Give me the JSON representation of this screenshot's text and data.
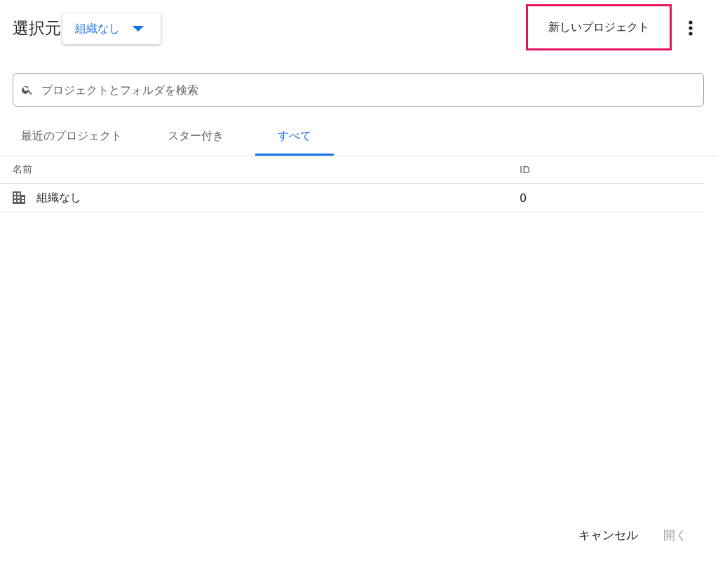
{
  "header": {
    "title": "選択元",
    "org_dropdown": {
      "value": "組織なし"
    },
    "new_project_button": {
      "label": "新しいプロジェクト",
      "highlighted": true
    }
  },
  "search": {
    "placeholder": "プロジェクトとフォルダを検索"
  },
  "tabs": [
    {
      "label": "最近のプロジェクト",
      "selected": false
    },
    {
      "label": "スター付き",
      "selected": false
    },
    {
      "label": "すべて",
      "selected": true
    }
  ],
  "table": {
    "columns": [
      "名前",
      "ID"
    ],
    "rows": [
      {
        "name": "組織なし",
        "id": "0",
        "kind": "organization"
      }
    ]
  },
  "buttons": [
    {
      "label": "キャンセル",
      "disabled": false
    },
    {
      "label": "開く",
      "disabled": true
    }
  ]
}
